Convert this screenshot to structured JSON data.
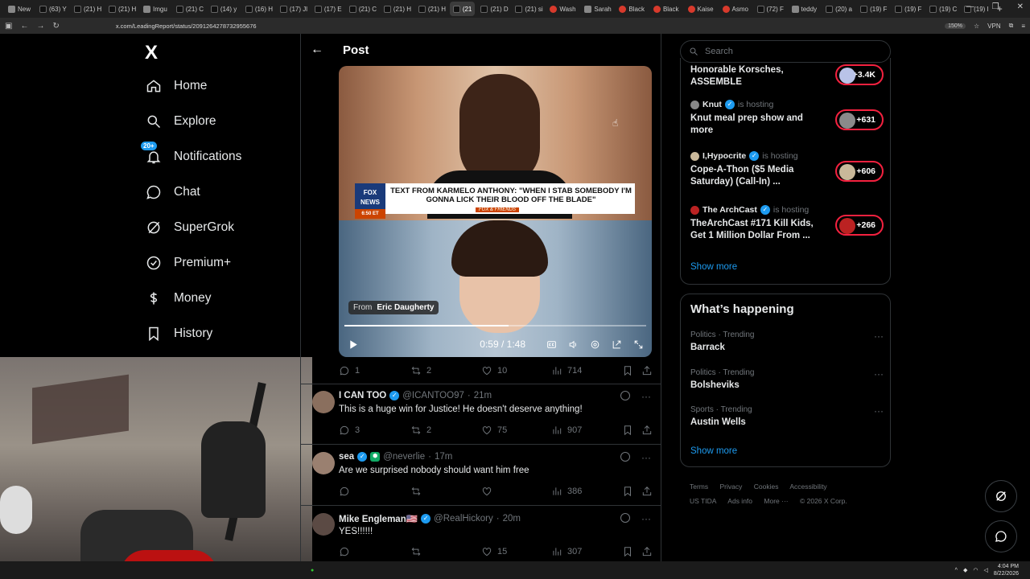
{
  "browser": {
    "tabs": [
      "New",
      "(63) Y",
      "(21) H",
      "(21) H",
      "Imgu",
      "(21) C",
      "(14) y",
      "(16) H",
      "(17) Jl",
      "(17) E",
      "(21) C",
      "(21) H",
      "(21) H",
      "(21",
      "(21) D",
      "(21) si",
      "Wash",
      "Sarah",
      "Black",
      "Black",
      "Kaise",
      "Asmo",
      "(72) F",
      "teddy",
      "(20) a",
      "(19) F",
      "(19) F",
      "(19) C",
      "(19) I"
    ],
    "active_tab_index": 13,
    "url": "x.com/LeadingReport/status/2091264278732955676",
    "zoom": "150%",
    "vpn": "VPN"
  },
  "nav": {
    "logo": "X",
    "items": [
      {
        "label": "Home",
        "icon": "home-icon"
      },
      {
        "label": "Explore",
        "icon": "search-icon"
      },
      {
        "label": "Notifications",
        "icon": "bell-icon",
        "badge": "20+"
      },
      {
        "label": "Chat",
        "icon": "chat-icon"
      },
      {
        "label": "SuperGrok",
        "icon": "grok-icon"
      },
      {
        "label": "Premium+",
        "icon": "verified-icon"
      },
      {
        "label": "Money",
        "icon": "dollar-icon"
      },
      {
        "label": "History",
        "icon": "bookmark-icon"
      }
    ]
  },
  "post": {
    "header_title": "Post",
    "video": {
      "chyron": "TEXT FROM KARMELO ANTHONY: \"WHEN I STAB SOMEBODY I'M GONNA LICK THEIR BLOOD OFF THE BLADE\"",
      "network": "FOX NEWS",
      "time_badge": "6:50 ET",
      "show": "FOX & FRIENDS",
      "from_label": "From",
      "from_name": "Eric Daugherty",
      "time": "0:59 / 1:48",
      "progress": 0.545
    },
    "stats": {
      "replies": "1",
      "reposts": "2",
      "likes": "10",
      "views": "714"
    }
  },
  "replies": [
    {
      "name": "I CAN TOO",
      "handle": "@ICANTOO97",
      "time": "21m",
      "text": "This is a huge win for Justice! He doesn't deserve anything!",
      "replies": "3",
      "reposts": "2",
      "likes": "75",
      "views": "907"
    },
    {
      "name": "sea",
      "handle": "@neverlie",
      "time": "17m",
      "text": "Are we surprised nobody should want him free",
      "replies": "",
      "reposts": "",
      "likes": "",
      "views": "386"
    },
    {
      "name": "Mike Engleman🇺🇸",
      "handle": "@RealHickory",
      "time": "20m",
      "text": "YES!!!!!!",
      "replies": "",
      "reposts": "",
      "likes": "15",
      "views": "307"
    }
  ],
  "right": {
    "search_placeholder": "Search",
    "spaces": [
      {
        "host": "",
        "status": "",
        "title": "Honorable Korsches, ASSEMBLE",
        "count": "+3.4K"
      },
      {
        "host": "Knut",
        "status": "is hosting",
        "title": "Knut meal prep show and more",
        "count": "+631"
      },
      {
        "host": "I,Hypocrite",
        "status": "is hosting",
        "title": "Cope-A-Thon ($5 Media Saturday) (Call-In) ...",
        "count": "+606"
      },
      {
        "host": "The ArchCast",
        "status": "is hosting",
        "title": "TheArchCast #171 Kill Kids, Get 1 Million Dollar From ...",
        "count": "+266"
      }
    ],
    "show_more": "Show more",
    "happening_title": "What’s happening",
    "trends": [
      {
        "category": "Politics · Trending",
        "name": "Barrack"
      },
      {
        "category": "Politics · Trending",
        "name": "Bolsheviks"
      },
      {
        "category": "Sports · Trending",
        "name": "Austin Wells"
      }
    ],
    "show_more_2": "Show more",
    "footer": [
      "Terms",
      "Privacy",
      "Cookies",
      "Accessibility",
      "US TIDA",
      "Ads info",
      "More ···",
      "© 2026 X Corp."
    ]
  },
  "taskbar": {
    "time": "4:04 PM",
    "date": "8/22/2026"
  }
}
